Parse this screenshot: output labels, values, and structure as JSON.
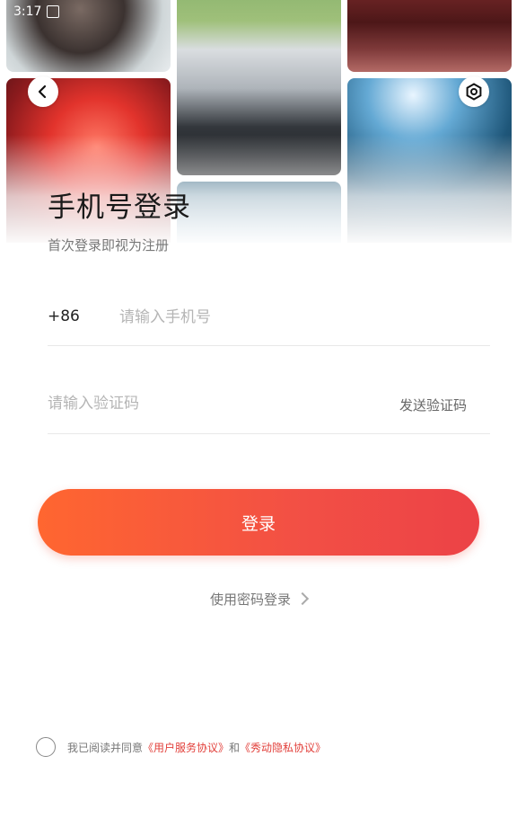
{
  "status_bar": {
    "time": "3:17",
    "sim_icon": "sim-card-icon"
  },
  "header": {
    "back_icon": "chevron-left-icon",
    "settings_icon": "hexagon-gear-icon"
  },
  "title": "手机号登录",
  "subtitle": "首次登录即视为注册",
  "phone": {
    "country_code": "+86",
    "placeholder": "请输入手机号",
    "value": ""
  },
  "verification": {
    "placeholder": "请输入验证码",
    "value": "",
    "send_label": "发送验证码"
  },
  "login_button": "登录",
  "password_login": "使用密码登录",
  "agreement": {
    "prefix": "我已阅读并同意",
    "user_agreement": "《用户服务协议》",
    "conjunction": "和",
    "privacy_policy": "《秀动隐私协议》",
    "checked": false
  },
  "colors": {
    "accent_start": "#ff6630",
    "accent_end": "#ec4246",
    "link": "#e2403b"
  }
}
